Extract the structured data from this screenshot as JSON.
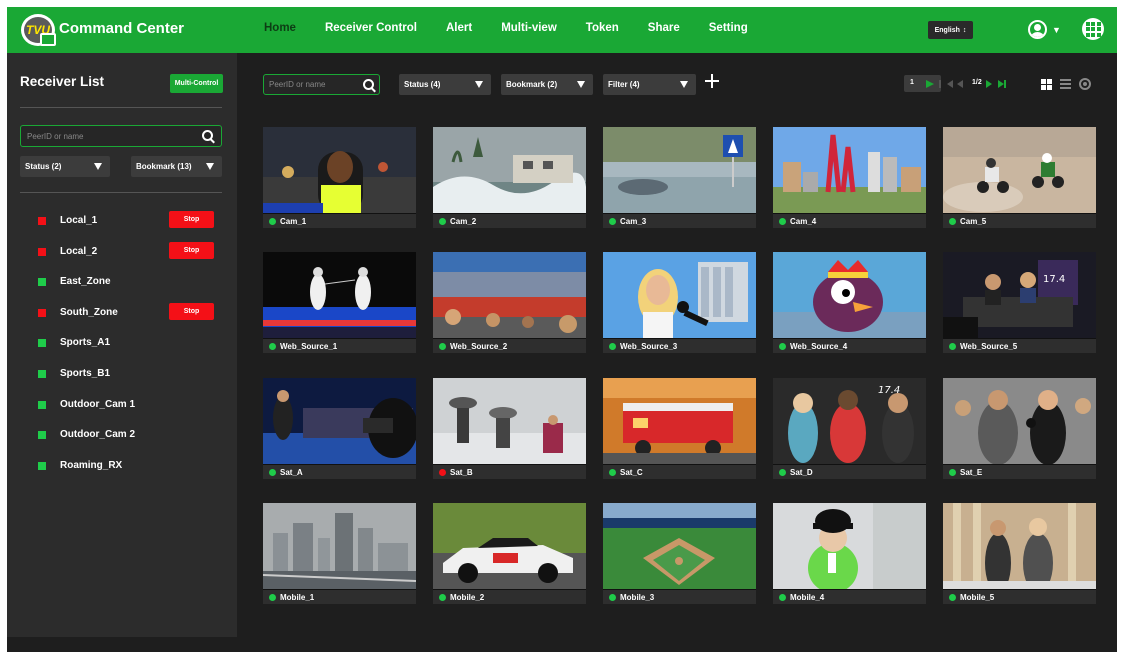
{
  "app": {
    "logo_text": "TVU",
    "title": "Command Center"
  },
  "nav": {
    "items": [
      "Home",
      "Receiver Control",
      "Alert",
      "Multi-view",
      "Token",
      "Share",
      "Setting"
    ],
    "active": "Home",
    "language": "English"
  },
  "sidebar": {
    "title": "Receiver List",
    "multi_control_label": "Multi-Control",
    "search_placeholder": "PeerID or name",
    "status_filter": "Status (2)",
    "bookmark_filter": "Bookmark (13)",
    "stop_label": "Stop",
    "receivers": [
      {
        "name": "Local_1",
        "status_color": "#f41017",
        "has_stop": true
      },
      {
        "name": "Local_2",
        "status_color": "#f41017",
        "has_stop": true
      },
      {
        "name": "East_Zone",
        "status_color": "#1fcc4a",
        "has_stop": false
      },
      {
        "name": "South_Zone",
        "status_color": "#f41017",
        "has_stop": true
      },
      {
        "name": "Sports_A1",
        "status_color": "#1fcc4a",
        "has_stop": false
      },
      {
        "name": "Sports_B1",
        "status_color": "#1fcc4a",
        "has_stop": false
      },
      {
        "name": "Outdoor_Cam 1",
        "status_color": "#1fcc4a",
        "has_stop": false
      },
      {
        "name": "Outdoor_Cam 2",
        "status_color": "#1fcc4a",
        "has_stop": false
      },
      {
        "name": "Roaming_RX",
        "status_color": "#1fcc4a",
        "has_stop": false
      }
    ]
  },
  "toolbar": {
    "search_placeholder": "PeerID or name",
    "status_filter": "Status (4)",
    "bookmark_filter": "Bookmark (2)",
    "filter": "Filter (4)",
    "page_input": "1",
    "page_label": "1/2"
  },
  "colors": {
    "brand_green": "#1aa835",
    "status_green": "#1fcc4a",
    "status_red": "#f41017"
  },
  "sources": [
    {
      "name": "Cam_1",
      "status_color": "#1fcc4a",
      "scene": "reporter-night"
    },
    {
      "name": "Cam_2",
      "status_color": "#1fcc4a",
      "scene": "storm-coast"
    },
    {
      "name": "Cam_3",
      "status_color": "#1fcc4a",
      "scene": "flooded-street"
    },
    {
      "name": "Cam_4",
      "status_color": "#1fcc4a",
      "scene": "city-sculpture"
    },
    {
      "name": "Cam_5",
      "status_color": "#1fcc4a",
      "scene": "motocross"
    },
    {
      "name": "Web_Source_1",
      "status_color": "#1fcc4a",
      "scene": "fencing"
    },
    {
      "name": "Web_Source_2",
      "status_color": "#1fcc4a",
      "scene": "stadium-track"
    },
    {
      "name": "Web_Source_3",
      "status_color": "#1fcc4a",
      "scene": "street-interview"
    },
    {
      "name": "Web_Source_4",
      "status_color": "#1fcc4a",
      "scene": "mascot"
    },
    {
      "name": "Web_Source_5",
      "status_color": "#1fcc4a",
      "scene": "studio-desk"
    },
    {
      "name": "Sat_A",
      "status_color": "#1fcc4a",
      "scene": "parade-camera"
    },
    {
      "name": "Sat_B",
      "status_color": "#f41017",
      "scene": "snow-street"
    },
    {
      "name": "Sat_C",
      "status_color": "#1fcc4a",
      "scene": "fire-truck"
    },
    {
      "name": "Sat_D",
      "status_color": "#1fcc4a",
      "scene": "athletes-interview"
    },
    {
      "name": "Sat_E",
      "status_color": "#1fcc4a",
      "scene": "crowd-interview"
    },
    {
      "name": "Mobile_1",
      "status_color": "#1fcc4a",
      "scene": "foggy-city"
    },
    {
      "name": "Mobile_2",
      "status_color": "#1fcc4a",
      "scene": "race-car"
    },
    {
      "name": "Mobile_3",
      "status_color": "#1fcc4a",
      "scene": "baseball-field"
    },
    {
      "name": "Mobile_4",
      "status_color": "#1fcc4a",
      "scene": "winter-interview"
    },
    {
      "name": "Mobile_5",
      "status_color": "#1fcc4a",
      "scene": "building-interview"
    }
  ]
}
